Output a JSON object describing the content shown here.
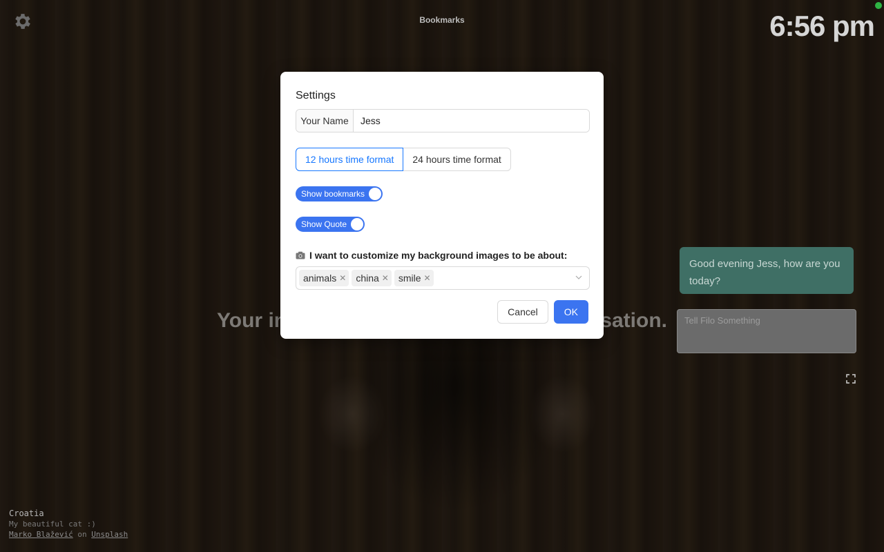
{
  "header": {
    "bookmarks_title": "Bookmarks",
    "clock": "6:56 pm"
  },
  "main": {
    "intro_left": "Your int",
    "intro_right": "rsation."
  },
  "chat": {
    "greeting": "Good evening Jess, how are you today?",
    "input_placeholder": "Tell Filo Something"
  },
  "credits": {
    "location": "Croatia",
    "description": "My beautiful cat :)",
    "author": "Marko Blažević",
    "on_text": "on",
    "source": "Unsplash"
  },
  "settings": {
    "title": "Settings",
    "name_label": "Your Name",
    "name_value": "Jess",
    "time_12": "12 hours time format",
    "time_24": "24 hours time format",
    "show_bookmarks": "Show bookmarks",
    "show_quote": "Show Quote",
    "bg_label": "I want to customize my background images to be about:",
    "tags": [
      "animals",
      "china",
      "smile"
    ],
    "cancel": "Cancel",
    "ok": "OK"
  },
  "colors": {
    "accent": "#3b74f0",
    "chat_bubble": "#3f6f65",
    "status": "#2fb344"
  }
}
